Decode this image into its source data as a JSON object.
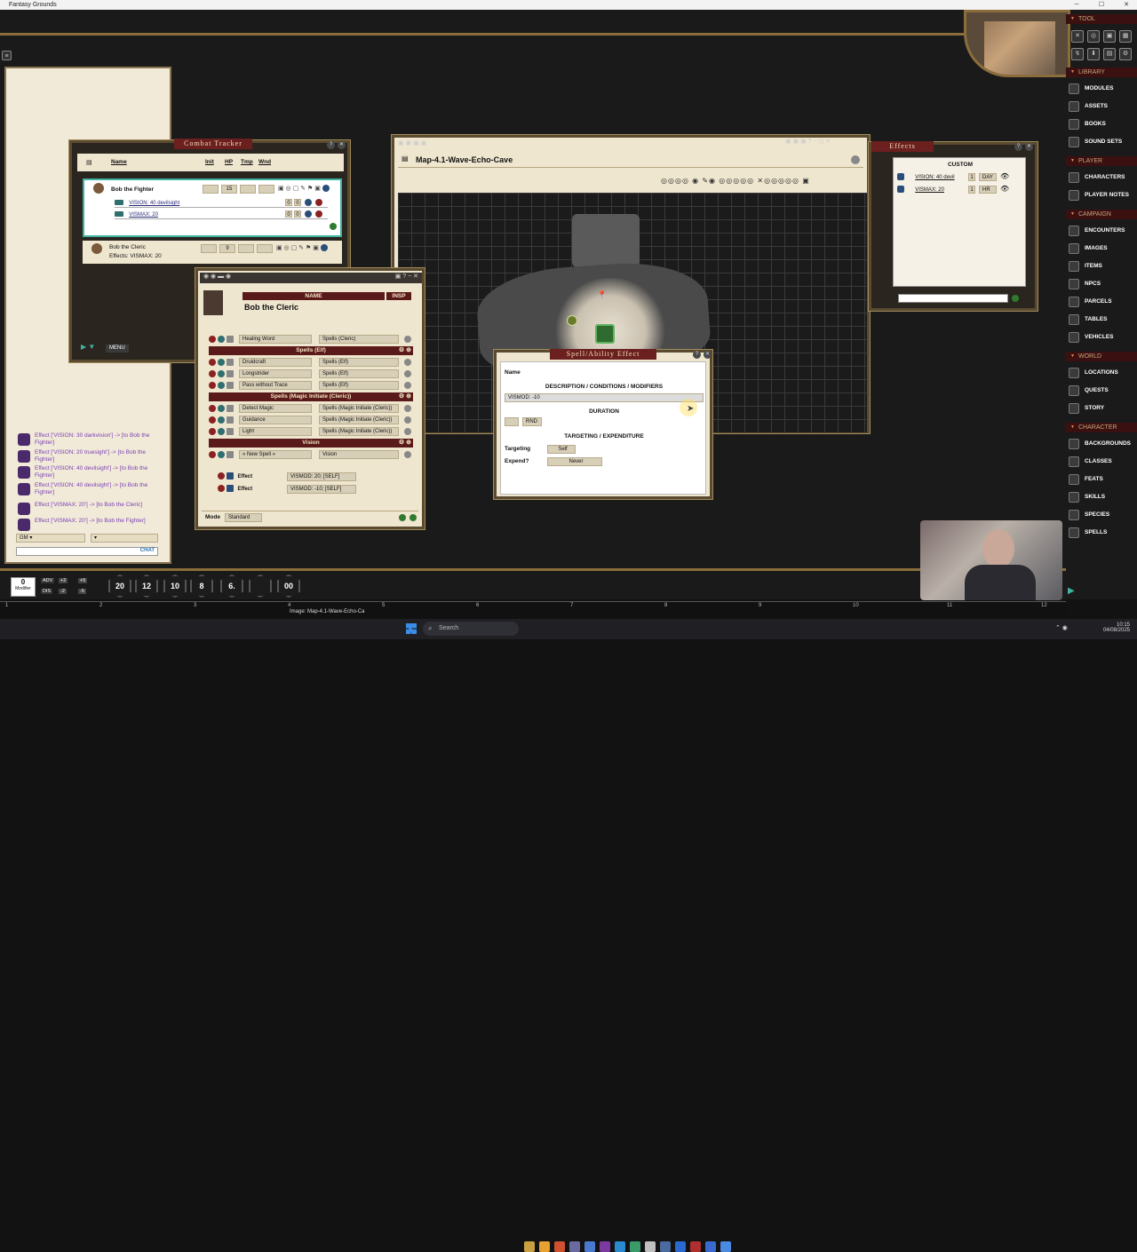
{
  "app": {
    "title": "Fantasy Grounds"
  },
  "combat_tracker": {
    "title": "Combat Tracker",
    "col_name": "Name",
    "col_init": "Init",
    "col_hp": "HP",
    "col_tmp": "Tmp",
    "col_wnd": "Wnd",
    "menu_label": "MENU",
    "rows": [
      {
        "name": "Bob the Fighter",
        "init": "",
        "hp": "15",
        "effects": [
          {
            "label": "VISION: 40 devilsight",
            "a": "0",
            "b": "0"
          },
          {
            "label": "VISMAX: 20",
            "a": "0",
            "b": "0"
          }
        ]
      },
      {
        "name": "Bob the Cleric",
        "init": "",
        "hp": "9",
        "effects_text": "Effects: VISMAX: 20"
      }
    ]
  },
  "map": {
    "title": "Map-4.1-Wave-Echo-Cave"
  },
  "effects": {
    "title": "Effects",
    "header": "CUSTOM",
    "rows": [
      {
        "label": "VISION: 40 devil",
        "count": "1",
        "unit": "DAY"
      },
      {
        "label": "VISMAX: 20",
        "count": "1",
        "unit": "HR"
      }
    ]
  },
  "charsheet": {
    "name_header": "NAME",
    "insp_header": "INSP",
    "name": "Bob the Cleric",
    "mode_label": "Mode",
    "mode_value": "Standard",
    "rows": [
      {
        "type": "spell",
        "name": "Healing Word",
        "source": "Spells (Cleric)"
      },
      {
        "type": "header",
        "name": "Spells (Elf)"
      },
      {
        "type": "spell",
        "name": "Druidcraft",
        "source": "Spells (Elf)"
      },
      {
        "type": "spell",
        "name": "Longstrider",
        "source": "Spells (Elf)"
      },
      {
        "type": "spell",
        "name": "Pass without Trace",
        "source": "Spells (Elf)"
      },
      {
        "type": "header",
        "name": "Spells (Magic Initiate (Cleric))"
      },
      {
        "type": "spell",
        "name": "Detect Magic",
        "source": "Spells (Magic Initiate (Cleric))"
      },
      {
        "type": "spell",
        "name": "Guidance",
        "source": "Spells (Magic Initiate (Cleric))"
      },
      {
        "type": "spell",
        "name": "Light",
        "source": "Spells (Magic Initiate (Cleric))"
      },
      {
        "type": "header",
        "name": "Vision"
      },
      {
        "type": "spell",
        "name": "« New Spell »",
        "source": "Vision"
      }
    ],
    "effect_rows": [
      {
        "label": "Effect",
        "value": "VISMOD: 20; [SELF]"
      },
      {
        "label": "Effect",
        "value": "VISMOD: -10; [SELF]"
      }
    ]
  },
  "spell_effect": {
    "title": "Spell/Ability Effect",
    "name_label": "Name",
    "desc_header": "DESCRIPTION / CONDITIONS / MODIFIERS",
    "desc_value": "VISMOD: -10",
    "duration_header": "DURATION",
    "duration_unit": "RND",
    "targeting_header": "TARGETING / EXPENDITURE",
    "targeting_label": "Targeting",
    "targeting_value": "Self",
    "expend_label": "Expend?",
    "expend_value": "Never"
  },
  "chat": {
    "lines": [
      "Effect ['VISION: 30 darkvision'] -> [to Bob the Fighter]",
      "Effect ['VISION: 20 truesight'] -> [to Bob the Fighter]",
      "Effect ['VISION: 40 devilsight'] -> [to Bob the Fighter]",
      "Effect ['VISION: 40 devilsight'] -> [to Bob the Fighter]",
      "Effect ['VISMAX: 20'] -> [to Bob the Cleric]",
      "Effect ['VISMAX: 20'] -> [to Bob the Fighter]"
    ],
    "identity": "GM",
    "chat_label": "CHAT"
  },
  "sidebar": {
    "tool": "TOOL",
    "sections": [
      {
        "title": "LIBRARY",
        "items": [
          "MODULES",
          "ASSETS",
          "BOOKS",
          "SOUND SETS"
        ]
      },
      {
        "title": "PLAYER",
        "items": [
          "CHARACTERS",
          "PLAYER NOTES"
        ]
      },
      {
        "title": "CAMPAIGN",
        "items": [
          "ENCOUNTERS",
          "IMAGES",
          "ITEMS",
          "NPCS",
          "PARCELS",
          "TABLES",
          "VEHICLES"
        ]
      },
      {
        "title": "WORLD",
        "items": [
          "LOCATIONS",
          "QUESTS",
          "STORY"
        ]
      },
      {
        "title": "CHARACTER",
        "items": [
          "BACKGROUNDS",
          "CLASSES",
          "FEATS",
          "SKILLS",
          "SPECIES",
          "SPELLS"
        ]
      }
    ]
  },
  "hotbar": {
    "modifier_value": "0",
    "modifier_label": "Modifier",
    "adv": "ADV",
    "dis": "DIS",
    "p2": "+2",
    "p5": "+5",
    "m2": "-2",
    "m5": "-5",
    "dice": [
      "20",
      "12",
      "10",
      "8",
      "6.",
      "",
      "00"
    ],
    "status": "Image: Map-4.1-Wave-Echo-Ca",
    "numbers": [
      "1",
      "2",
      "3",
      "4",
      "5",
      "6",
      "7",
      "8",
      "9",
      "10",
      "11",
      "12"
    ]
  },
  "taskbar": {
    "search": "Search",
    "time": "10:15",
    "date": "04/08/2025"
  }
}
